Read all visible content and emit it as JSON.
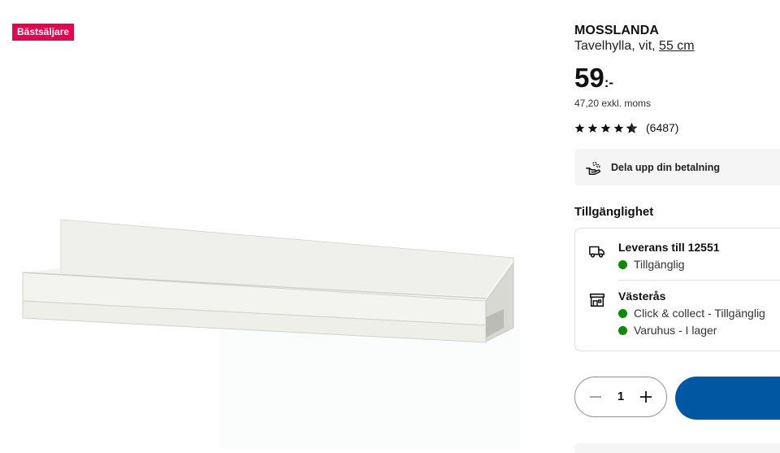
{
  "badge": {
    "label": "Bästsäljare",
    "color": "#e00751"
  },
  "product": {
    "name": "MOSSLANDA",
    "description": "Tavelhylla, vit,",
    "size_link": "55 cm",
    "price": "59",
    "price_suffix": ":-",
    "price_excl": "47,20 exkl. moms",
    "rating": {
      "stars": 4.5,
      "max": 5,
      "count": "(6487)"
    },
    "image_icon": "wall-shelf"
  },
  "payment": {
    "label": "Dela upp din betalning",
    "icon": "hand-coins-icon"
  },
  "availability": {
    "title": "Tillgänglighet",
    "delivery": {
      "icon": "truck-icon",
      "title": "Leverans till 12551",
      "status": "Tillgänglig",
      "status_color": "#0a8a00"
    },
    "store": {
      "icon": "store-icon",
      "title": "Västerås",
      "statuses": [
        "Click & collect - Tillgänglig",
        "Varuhus - I lager"
      ],
      "status_color": "#0a8a00"
    }
  },
  "quantity": {
    "value": "1",
    "minus_icon": "minus-icon",
    "plus_icon": "plus-icon"
  },
  "colors": {
    "brand_blue": "#0058a3",
    "banner_bg": "#f5f5f5"
  }
}
